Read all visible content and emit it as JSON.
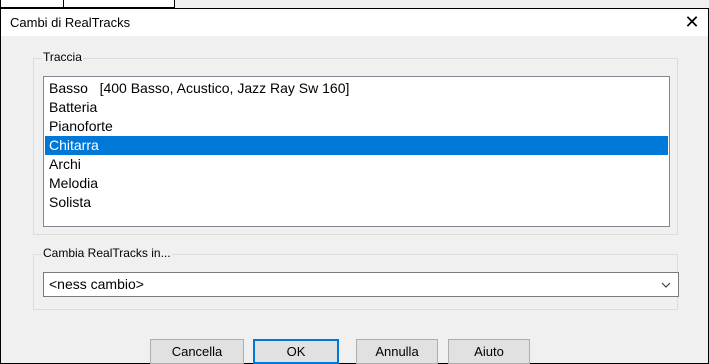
{
  "window": {
    "title": "Cambi di RealTracks",
    "close_glyph": "✕"
  },
  "track_group": {
    "label": "Traccia",
    "items": [
      {
        "label": "Basso   [400 Basso, Acustico, Jazz Ray Sw 160]",
        "selected": false
      },
      {
        "label": "Batteria",
        "selected": false
      },
      {
        "label": "Pianoforte",
        "selected": false
      },
      {
        "label": "Chitarra",
        "selected": true
      },
      {
        "label": "Archi",
        "selected": false
      },
      {
        "label": "Melodia",
        "selected": false
      },
      {
        "label": "Solista",
        "selected": false
      }
    ]
  },
  "change_group": {
    "label": "Cambia RealTracks in...",
    "selected_value": "<ness cambio>"
  },
  "buttons": {
    "cancella": "Cancella",
    "ok": "OK",
    "annulla": "Annulla",
    "aiuto": "Aiuto"
  },
  "colors": {
    "selection": "#0078d7",
    "dialog_bg": "#f0f0f0"
  }
}
